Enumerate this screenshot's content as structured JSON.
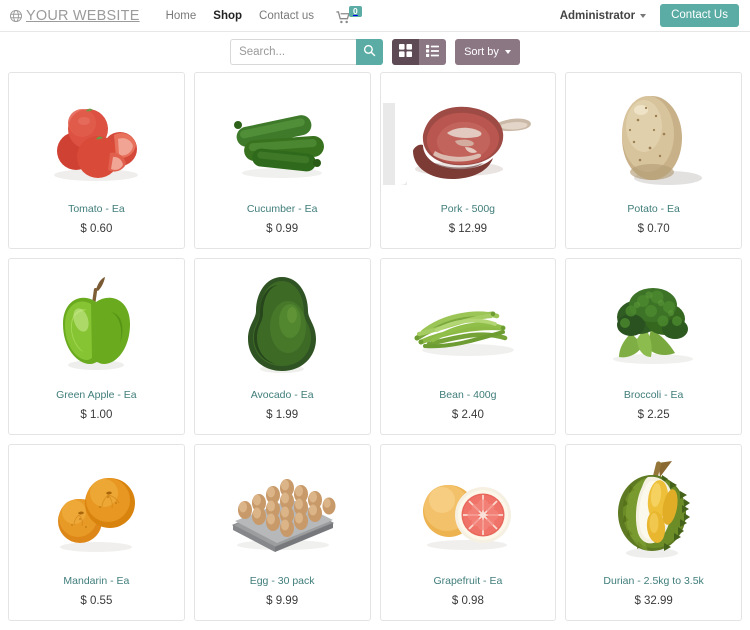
{
  "header": {
    "brand": "YOUR WEBSITE",
    "brand_icon": "globe-icon",
    "nav": [
      {
        "label": "Home",
        "active": false
      },
      {
        "label": "Shop",
        "active": true
      },
      {
        "label": "Contact us",
        "active": false
      }
    ],
    "cart": {
      "icon": "shopping-cart-icon",
      "count": "0"
    },
    "user_menu": {
      "label": "Administrator",
      "icon": "chevron-down-icon"
    },
    "contact_button": "Contact Us",
    "accent_color": "#5aaca4"
  },
  "toolbar": {
    "search_placeholder": "Search...",
    "search_value": "",
    "search_icon": "search-icon",
    "grid_view_label": "grid-view",
    "list_view_label": "list-view",
    "active_view": "grid",
    "sort_label": "Sort by",
    "control_color": "#8b7683",
    "control_active_color": "#5d4a55"
  },
  "products": [
    {
      "name": "Tomato - Ea",
      "price": "$ 0.60",
      "image": "tomato-image"
    },
    {
      "name": "Cucumber - Ea",
      "price": "$ 0.99",
      "image": "cucumber-image"
    },
    {
      "name": "Pork - 500g",
      "price": "$ 12.99",
      "image": "pork-image"
    },
    {
      "name": "Potato - Ea",
      "price": "$ 0.70",
      "image": "potato-image"
    },
    {
      "name": "Green Apple - Ea",
      "price": "$ 1.00",
      "image": "green-apple-image"
    },
    {
      "name": "Avocado - Ea",
      "price": "$ 1.99",
      "image": "avocado-image"
    },
    {
      "name": "Bean - 400g",
      "price": "$ 2.40",
      "image": "bean-image"
    },
    {
      "name": "Broccoli - Ea",
      "price": "$ 2.25",
      "image": "broccoli-image"
    },
    {
      "name": "Mandarin - Ea",
      "price": "$ 0.55",
      "image": "mandarin-image"
    },
    {
      "name": "Egg - 30 pack",
      "price": "$ 9.99",
      "image": "egg-tray-image"
    },
    {
      "name": "Grapefruit - Ea",
      "price": "$ 0.98",
      "image": "grapefruit-image"
    },
    {
      "name": "Durian - 2.5kg to 3.5k",
      "price": "$ 32.99",
      "image": "durian-image"
    }
  ]
}
